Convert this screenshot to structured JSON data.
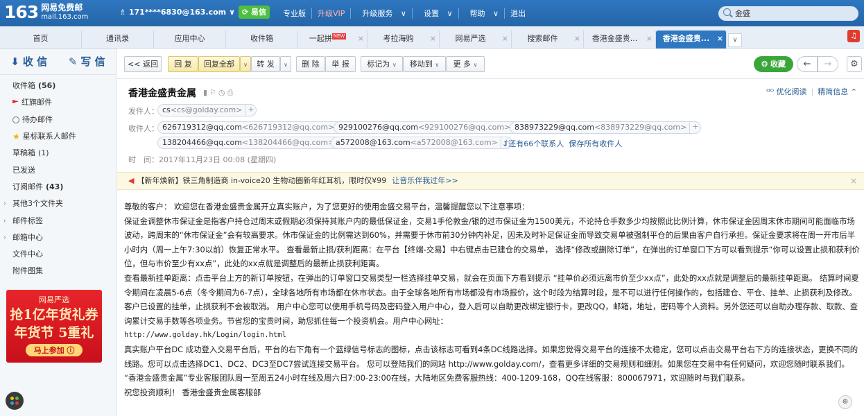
{
  "app": {
    "logo_number": "163",
    "logo_line1": "网易免费邮",
    "logo_line2": "mail.163.com",
    "account": "171****6830@163.com",
    "yixin": "易信",
    "top_nav": [
      "专业版",
      "升级VIP",
      "升级服务",
      "设置",
      "帮助",
      "退出"
    ],
    "search_value": "金盛"
  },
  "tabs": [
    {
      "label": "首页"
    },
    {
      "label": "通讯录"
    },
    {
      "label": "应用中心"
    },
    {
      "label": "收件箱"
    },
    {
      "label": "一起拼",
      "badge": "NEW"
    },
    {
      "label": "考拉海购"
    },
    {
      "label": "网易严选"
    },
    {
      "label": "搜索邮件"
    },
    {
      "label": "香港金盛贵..."
    },
    {
      "label": "香港金盛贵..."
    }
  ],
  "sidebar": {
    "receive": "收 信",
    "write": "写 信",
    "items": [
      {
        "label": "收件箱",
        "count": "(56)"
      },
      {
        "label": "红旗邮件"
      },
      {
        "label": "待办邮件"
      },
      {
        "label": "星标联系人邮件"
      },
      {
        "label": "草稿箱",
        "count": "(1)"
      },
      {
        "label": "已发送"
      },
      {
        "label": "订阅邮件",
        "count": "(43)"
      },
      {
        "label": "其他3个文件夹"
      },
      {
        "label": "邮件标签"
      },
      {
        "label": "邮箱中心"
      },
      {
        "label": "文件中心"
      },
      {
        "label": "附件图集"
      }
    ],
    "ad": {
      "brand": "网易严选",
      "line1": "抢1亿年货礼券",
      "line2": "年货节 5重礼",
      "cta": "马上参加 ⓘ"
    }
  },
  "toolbar": {
    "back": "<< 返回",
    "reply": "回 复",
    "reply_all": "回复全部",
    "forward": "转 发",
    "delete": "删 除",
    "report": "举 报",
    "mark_as": "标记为",
    "move_to": "移动到",
    "more": "更 多",
    "favorite": "收藏"
  },
  "email": {
    "subject": "香港金盛贵金属",
    "optimize_read": "优化阅读",
    "concise_info": "精简信息",
    "sender_label": "发件人：",
    "sender": {
      "name": "cs",
      "addr": "<cs@golday.com>"
    },
    "recipients_label": "收件人：",
    "recipients": [
      {
        "name": "626719312@qq.com",
        "addr": "<626719312@qq.com>"
      },
      {
        "name": "929100276@qq.com",
        "addr": "<929100276@qq.com>"
      },
      {
        "name": "838973229@qq.com",
        "addr": "<838973229@qq.com>"
      },
      {
        "name": "138204466@qq.com",
        "addr": "<138204466@qq.com>"
      },
      {
        "name": "a572008@163.com",
        "addr": "<a572008@163.com>"
      }
    ],
    "more_recipients": "↓还有66个联系人",
    "save_all": "保存所有收件人",
    "time": "时　间：2017年11月23日 00:08 (星期四)"
  },
  "adbar": {
    "text": "【新年焕新】铁三角制造商 in-voice20 生物动圈新年红耳机，限时仅¥99",
    "link": "让音乐伴我过年>>"
  },
  "body": {
    "p1": "尊敬的客户：  欢迎您在香港金盛贵金属开立真实账户，为了您更好的使用金盛交易平台，温馨提醒您以下注意事项：",
    "p2": "  保证金调整休市保证金是指客户持仓过周末或假期必须保持其账户内的最低保证金，交易1手伦敦金/银的过市保证金为1500美元，不论持仓手数多少均按照此比例计算，休市保证金因周末休市期间可能面临市场波动，跨周末的“休市保证金”会有较高要求。休市保证金的比例需达到60%，并需要于休市前30分钟内补足，因未及时补足保证金而导致交易单被强制平仓的后果由客户自行承担。保证金要求将在周一开市后半小时内（周一上午7:30以前）恢复正常水平。  查看最新止损/获利距离：在平台【终端-交易】中右键点击已建仓的交易单，  选择“修改或删除订单”，在弹出的订单窗口下方可以看到提示“你可以设置止损和获利价位，但与市价至少有xx点”，此处的xx点就是调整后的最新止损获利距离。",
    "p3": "  查看最新挂单距离：点击平台上方的新订单按钮，在弹出的订单窗口交易类型一栏选择挂单交易，就会在页面下方看到提示 “挂单价必须远离市价至少xx点”，此处的xx点就是调整后的最新挂单距离。  结算时间夏令期间在凌晨5-6点（冬令期间为6-7点），全球各地所有市场都在休市状态。由于全球各地所有市场都没有市场报价，这个时段为结算时段，是不可以进行任何操作的，包括建仓、平仓、挂单、止损获利及修改。客户已设置的挂单，止损获利不会被取消。  用户中心您可以使用手机号码及密码登入用户中心，登入后可以自助更改绑定银行卡，更改QQ，邮箱，地址，密码等个人资料。另外您还可以自助办理存款、取款、查询累计交易手数等各项业务。节省您的宝贵时间，助您抓住每一个投资机会。用户中心网址：",
    "url": "http://www.golday.hk/Login/login.html",
    "p4": "  真实账户平台DC 成功登入交易平台后，平台的右下角有一个蓝绿信号标志的图标，点击该标志可看到4条DC线路选择。如果您觉得交易平台的连接不太稳定，您可以点击交易平台右下方的连接状态，更换不同的线路。您可以点击选择DC1、DC2、DC3至DC7尝试连接交易平台。  您可以登陆我们的网站 http://www.golday.com/，查看更多详细的交易规则和细则。如果您在交易中有任何疑问，欢迎您随时联系我们。  “香港金盛贵金属”专业客服团队周一至周五24小时在线及周六日7:00-23:00在线，大陆地区免费客服热线：400-1209-168，QQ在线客服：800067971，欢迎随时与我们联系。",
    "p5": "  祝您投资顺利！  香港金盛贵金属客服部"
  }
}
